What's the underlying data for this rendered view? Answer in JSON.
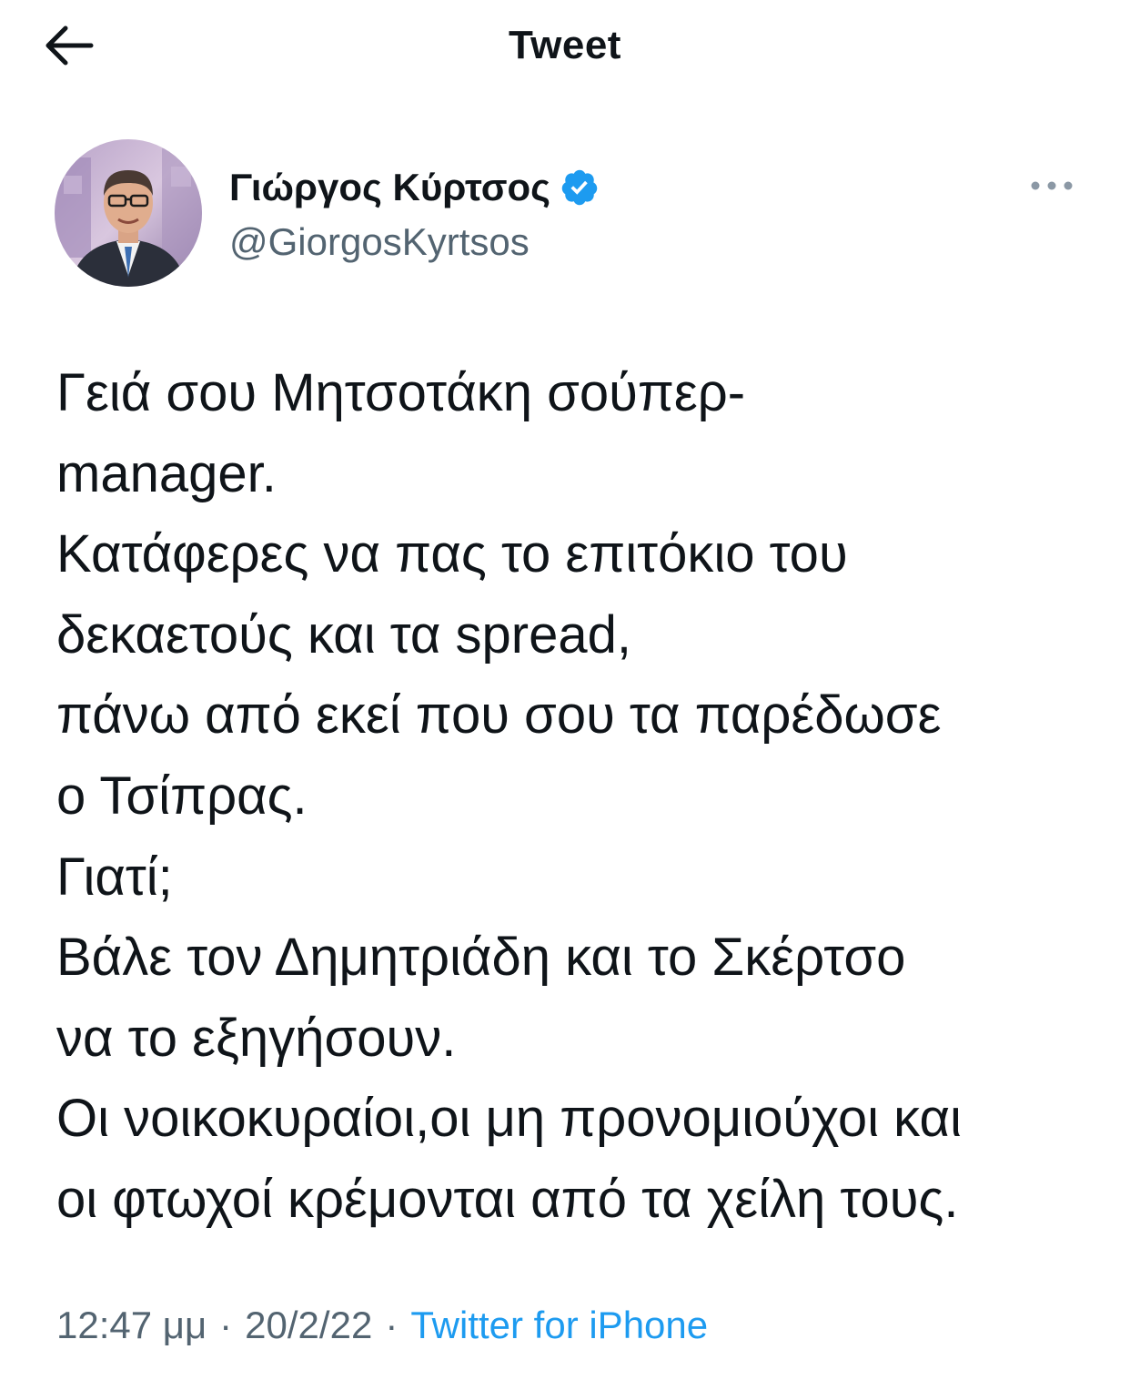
{
  "header": {
    "title": "Tweet",
    "back_icon": "arrow-left-icon"
  },
  "tweet": {
    "author": {
      "display_name": "Γιώργος Κύρτσος",
      "handle": "@GiorgosKyrtsos",
      "verified": true,
      "verified_icon": "verified-badge-icon",
      "verified_color": "#1d9bf0"
    },
    "more_icon": "more-options-icon",
    "text": "Γειά σου Μητσοτάκη σούπερ-\nmanager.\nΚατάφερες να πας το επιτόκιο του\nδεκαετούς και τα spread,\nπάνω από εκεί που σου τα παρέδωσε\nο Τσίπρας.\nΓιατί;\nΒάλε τον Δημητριάδη και το Σκέρτσο\nνα το εξηγήσουν.\nΟι νοικοκυραίοι,οι μη προνομιούχοι και\nοι φτωχοί κρέμονται από τα χείλη τους.",
    "time": "12:47 μμ",
    "separator": "·",
    "date": "20/2/22",
    "source": "Twitter for iPhone",
    "source_color": "#1d9bf0"
  }
}
